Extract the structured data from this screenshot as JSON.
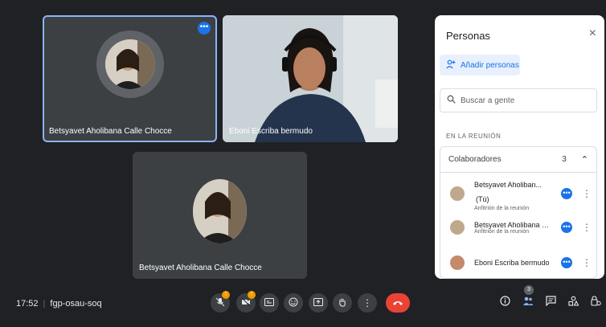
{
  "tiles": {
    "t1": {
      "name": "Betsyavet Aholibana Calle Chocce"
    },
    "t2": {
      "name": "Eboni Escriba bermudo"
    },
    "t3": {
      "name": "Betsyavet Aholibana Calle Chocce"
    },
    "more": "•••"
  },
  "panel": {
    "title": "Personas",
    "close": "×",
    "add_label": "Añadir personas",
    "search_placeholder": "Buscar a gente",
    "section": "EN LA REUNIÓN",
    "group": {
      "label": "Colaboradores",
      "count": "3",
      "chev": "⌃"
    },
    "people": [
      {
        "name": "Betsyavet Aholiban...",
        "suffix": "(Tú)",
        "role": "Anfitrión de la reunión"
      },
      {
        "name": "Betsyavet Aholibana Cal...",
        "suffix": "",
        "role": "Anfitrión de la reunión"
      },
      {
        "name": "Eboni Escriba bermudo",
        "suffix": "",
        "role": ""
      }
    ],
    "kebab": "⋮"
  },
  "bar": {
    "time": "17:52",
    "sep": "|",
    "code": "fgp-osau-soq",
    "warn": "!",
    "badge_count": "3"
  }
}
